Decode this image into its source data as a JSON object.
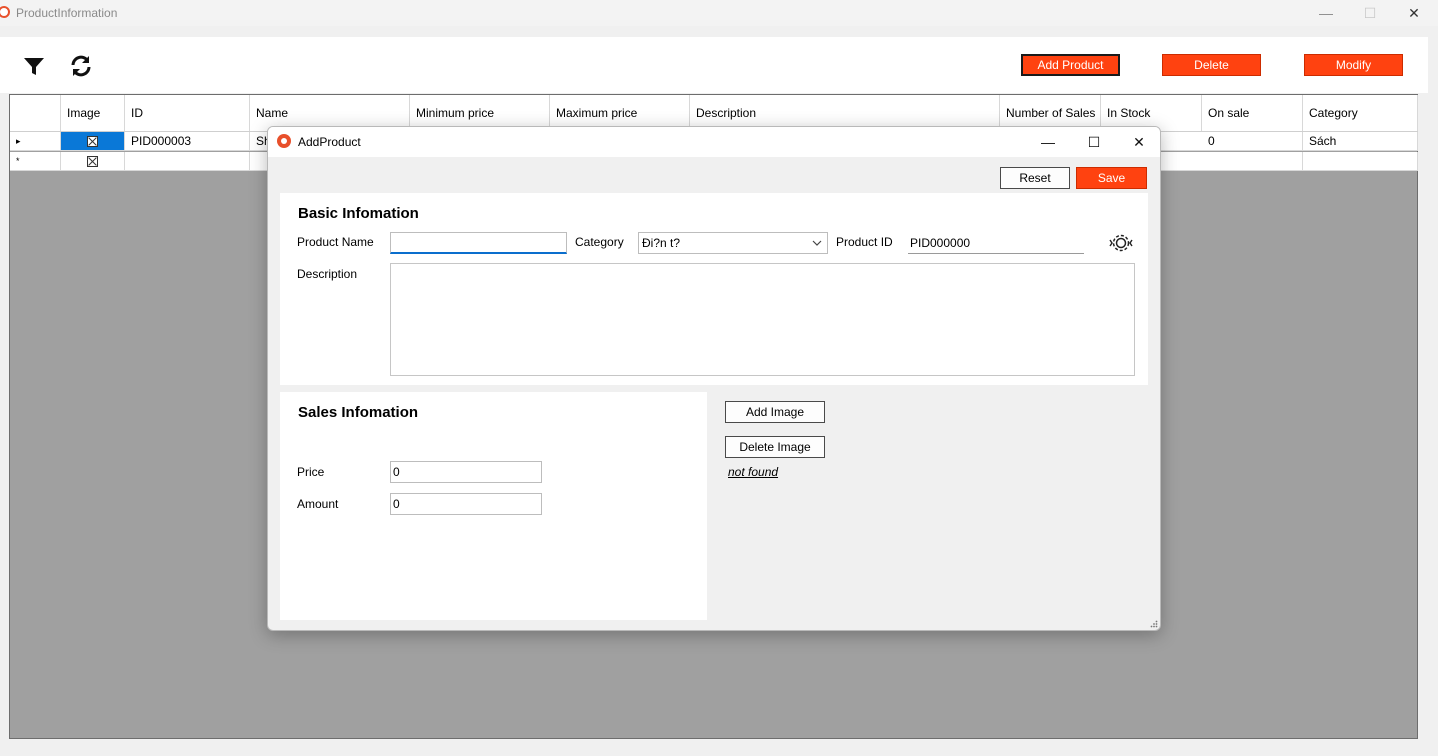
{
  "window": {
    "title": "ProductInformation",
    "minimize": "—",
    "maximize": "☐",
    "close": "✕"
  },
  "toolbar": {
    "add_label": "Add Product",
    "delete_label": "Delete",
    "modify_label": "Modify"
  },
  "grid": {
    "columns": [
      "Image",
      "ID",
      "Name",
      "Minimum price",
      "Maximum price",
      "Description",
      "Number of Sales",
      "In Stock",
      "On sale",
      "Category"
    ],
    "rows": [
      {
        "marker": "▸",
        "id": "PID000003",
        "name": "Sh",
        "on_sale": "0",
        "category": "Sách"
      },
      {
        "marker": "*",
        "id": "",
        "name": "",
        "on_sale": "",
        "category": ""
      }
    ]
  },
  "dialog": {
    "title": "AddProduct",
    "minimize": "—",
    "maximize": "☐",
    "close": "✕",
    "reset_label": "Reset",
    "save_label": "Save",
    "basic_title": "Basic Infomation",
    "product_name_label": "Product Name",
    "product_name_value": "",
    "category_label": "Category",
    "category_value": "Đi?n t?",
    "product_id_label": "Product ID",
    "product_id_value": "PID000000",
    "description_label": "Description",
    "sales_title": "Sales Infomation",
    "price_label": "Price",
    "price_value": "0",
    "amount_label": "Amount",
    "amount_value": "0",
    "add_image_label": "Add Image",
    "delete_image_label": "Delete Image",
    "image_status": "not found"
  },
  "colors": {
    "accent_red": "#ff4210",
    "selection_blue": "#0a78d7",
    "grid_bg": "#a0a0a0"
  }
}
